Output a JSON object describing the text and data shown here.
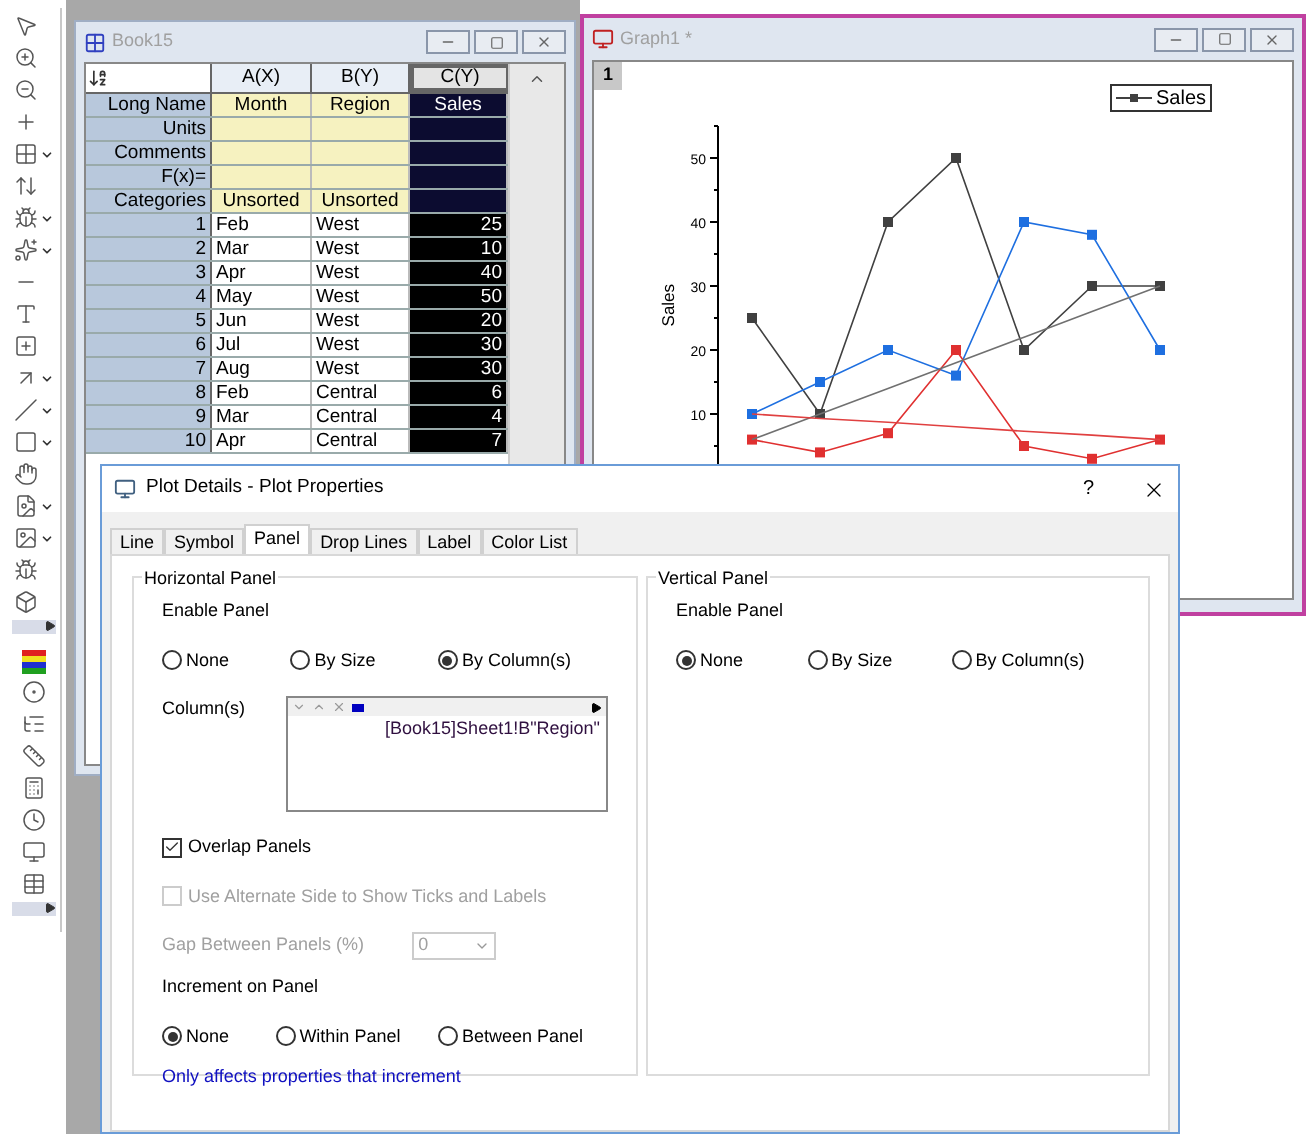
{
  "workbook": {
    "title": "Book15",
    "columns": [
      {
        "label": "A(X)",
        "selected": false
      },
      {
        "label": "B(Y)",
        "selected": false
      },
      {
        "label": "C(Y)",
        "selected": true
      }
    ],
    "label_rows": [
      {
        "label": "Long Name",
        "values": [
          "Month",
          "Region",
          "Sales"
        ]
      },
      {
        "label": "Units"
      },
      {
        "label": "Comments"
      },
      {
        "label": "F(x)="
      },
      {
        "label": "Categories",
        "values": [
          "Unsorted",
          "Unsorted"
        ]
      }
    ],
    "rows": [
      {
        "num": "1",
        "cells": [
          "Feb",
          "West",
          "25"
        ]
      },
      {
        "num": "2",
        "cells": [
          "Mar",
          "West",
          "10"
        ]
      },
      {
        "num": "3",
        "cells": [
          "Apr",
          "West",
          "40"
        ]
      },
      {
        "num": "4",
        "cells": [
          "May",
          "West",
          "50"
        ]
      },
      {
        "num": "5",
        "cells": [
          "Jun",
          "West",
          "20"
        ]
      },
      {
        "num": "6",
        "cells": [
          "Jul",
          "West",
          "30"
        ]
      },
      {
        "num": "7",
        "cells": [
          "Aug",
          "West",
          "30"
        ]
      },
      {
        "num": "8",
        "cells": [
          "Feb",
          "Central",
          "6"
        ]
      },
      {
        "num": "9",
        "cells": [
          "Mar",
          "Central",
          "4"
        ]
      },
      {
        "num": "10",
        "cells": [
          "Apr",
          "Central",
          "7"
        ]
      }
    ]
  },
  "graph": {
    "title": "Graph1 *",
    "layer": "1",
    "legend": "Sales",
    "chart_data": {
      "type": "line",
      "ylabel": "Sales",
      "yticks": [
        10,
        20,
        30,
        40,
        50
      ],
      "ylim": [
        0,
        55
      ],
      "series": [
        {
          "color": "#404040",
          "marker": "square",
          "values": [
            25,
            10,
            40,
            50,
            20,
            30,
            30
          ]
        },
        {
          "color": "#1e6fe0",
          "marker": "square",
          "values": [
            10,
            15,
            20,
            16,
            40,
            38,
            20
          ]
        },
        {
          "color": "#e03030",
          "marker": "square",
          "values": [
            6,
            4,
            7,
            20,
            5,
            3,
            6
          ]
        },
        {
          "color": "#707070",
          "values": [
            6,
            10,
            14,
            18,
            22,
            26,
            30
          ]
        },
        {
          "color": "#e04040",
          "values": [
            10,
            9.3,
            8.7,
            8,
            7.3,
            6.7,
            6
          ]
        }
      ]
    }
  },
  "dialog": {
    "title": "Plot Details - Plot Properties",
    "help": "?",
    "tabs": [
      {
        "label": "Line",
        "selected": false
      },
      {
        "label": "Symbol",
        "selected": false
      },
      {
        "label": "Panel",
        "selected": true
      },
      {
        "label": "Drop Lines",
        "selected": false
      },
      {
        "label": "Label",
        "selected": false
      },
      {
        "label": "Color List",
        "selected": false
      }
    ],
    "horizontal_panel": {
      "title": "Horizontal Panel",
      "enable_label": "Enable Panel",
      "enable_options": [
        {
          "label": "None",
          "selected": false
        },
        {
          "label": "By Size",
          "selected": false
        },
        {
          "label": "By Column(s)",
          "selected": true
        }
      ],
      "columns_label": "Column(s)",
      "columns": [
        "[Book15]Sheet1!B\"Region\""
      ],
      "overlap": {
        "label": "Overlap Panels",
        "checked": true,
        "disabled": false
      },
      "alternate_side": {
        "label": "Use Alternate Side to Show Ticks and Labels",
        "checked": false,
        "disabled": true
      },
      "gap": {
        "label": "Gap Between Panels (%)",
        "value": "0",
        "disabled": true
      },
      "increment_label": "Increment on Panel",
      "increment_options": [
        {
          "label": "None",
          "selected": true
        },
        {
          "label": "Within Panel",
          "selected": false
        },
        {
          "label": "Between Panel",
          "selected": false
        }
      ],
      "note": "Only affects properties that increment"
    },
    "vertical_panel": {
      "title": "Vertical Panel",
      "enable_label": "Enable Panel",
      "enable_options": [
        {
          "label": "None",
          "selected": true
        },
        {
          "label": "By Size",
          "selected": false
        },
        {
          "label": "By Column(s)",
          "selected": false
        }
      ]
    }
  }
}
